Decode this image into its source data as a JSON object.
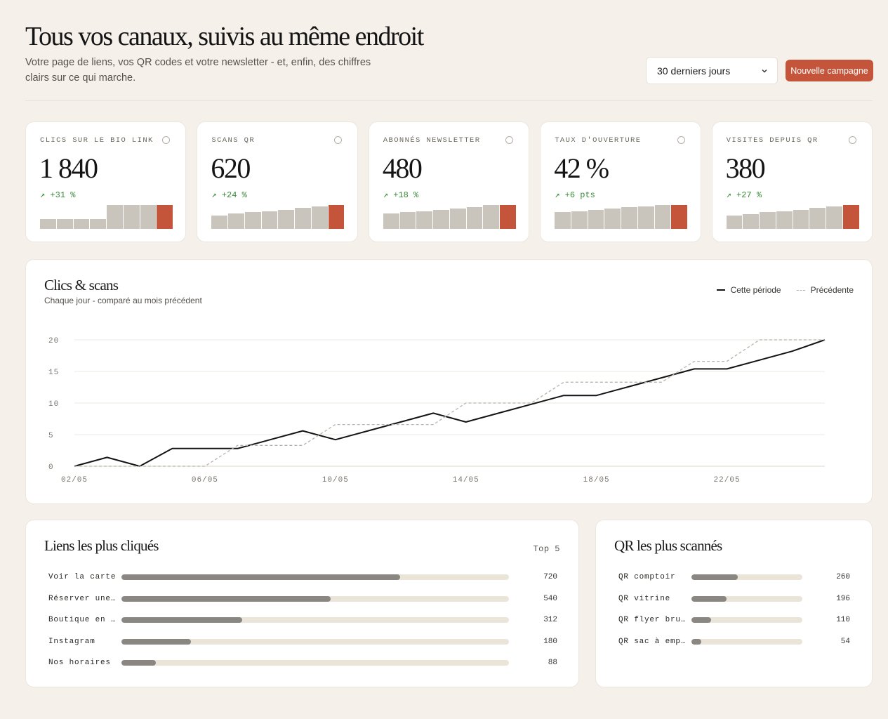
{
  "header": {
    "title": "Tous vos canaux, suivis au même endroit",
    "subtitle": "Votre page de liens, vos QR codes et votre newsletter - et, enfin, des chiffres clairs sur ce qui marche.",
    "period": "30 derniers jours",
    "cta": "Nouvelle campagne"
  },
  "kpis": [
    {
      "label": "CLICS SUR LE BIO LINK",
      "value": "1 840",
      "delta": "↗ +31 %",
      "spark": [
        0.4,
        0.4,
        0.4,
        0.4,
        1,
        1,
        1,
        1
      ]
    },
    {
      "label": "SCANS QR",
      "value": "620",
      "delta": "↗ +24 %",
      "spark": [
        0.55,
        0.65,
        0.7,
        0.75,
        0.8,
        0.88,
        0.95,
        1
      ]
    },
    {
      "label": "ABONNÉS NEWSLETTER",
      "value": "480",
      "delta": "↗ +18 %",
      "spark": [
        0.65,
        0.7,
        0.75,
        0.8,
        0.85,
        0.9,
        1,
        1
      ]
    },
    {
      "label": "TAUX D'OUVERTURE",
      "value": "42 %",
      "delta": "↗ +6 pts",
      "spark": [
        0.7,
        0.75,
        0.8,
        0.85,
        0.9,
        0.95,
        1,
        1
      ]
    },
    {
      "label": "VISITES DEPUIS QR",
      "value": "380",
      "delta": "↗ +27 %",
      "spark": [
        0.55,
        0.62,
        0.7,
        0.75,
        0.8,
        0.88,
        0.95,
        1
      ]
    }
  ],
  "main": {
    "title": "Clics & scans",
    "subtitle": "Chaque jour - comparé au mois précédent",
    "legend_current": "Cette période",
    "legend_previous": "Précédente"
  },
  "chart_data": {
    "type": "line",
    "x": [
      "02/05",
      "03/05",
      "04/05",
      "05/05",
      "06/05",
      "07/05",
      "08/05",
      "09/05",
      "10/05",
      "11/05",
      "12/05",
      "13/05",
      "14/05",
      "15/05",
      "16/05",
      "17/05",
      "18/05",
      "19/05",
      "20/05",
      "21/05",
      "22/05",
      "23/05",
      "24/05",
      "25/05"
    ],
    "x_ticks": [
      "02/05",
      "06/05",
      "10/05",
      "14/05",
      "18/05",
      "22/05"
    ],
    "y_ticks": [
      0,
      5,
      10,
      15,
      20
    ],
    "ylim": [
      0,
      20
    ],
    "grid": true,
    "legend": "top-right",
    "series": [
      {
        "name": "Cette période",
        "style": "solid",
        "values": [
          0,
          1.4,
          0,
          2.8,
          2.8,
          2.8,
          4.2,
          5.6,
          4.2,
          5.6,
          7.0,
          8.4,
          7.0,
          8.4,
          9.8,
          11.2,
          11.2,
          12.6,
          14.0,
          15.4,
          15.4,
          16.8,
          18.2,
          20
        ]
      },
      {
        "name": "Précédente",
        "style": "dashed",
        "values": [
          0,
          0,
          0,
          0,
          0,
          3.3,
          3.3,
          3.3,
          6.6,
          6.6,
          6.6,
          6.6,
          10,
          10,
          10,
          13.3,
          13.3,
          13.3,
          13.3,
          16.6,
          16.6,
          20,
          20,
          20
        ]
      }
    ],
    "colors": {
      "current": "#141414",
      "previous": "#b8b3aa"
    }
  },
  "links": {
    "title": "Liens les plus cliqués",
    "badge": "Top 5",
    "max": 1000,
    "items": [
      {
        "label": "Voir la carte",
        "value": 720
      },
      {
        "label": "Réserver une…",
        "value": 540
      },
      {
        "label": "Boutique en …",
        "value": 312
      },
      {
        "label": "Instagram",
        "value": 180
      },
      {
        "label": "Nos horaires",
        "value": 88
      }
    ]
  },
  "qrs": {
    "title": "QR les plus scannés",
    "max": 620,
    "items": [
      {
        "label": "QR comptoir",
        "value": 260
      },
      {
        "label": "QR vitrine",
        "value": 196
      },
      {
        "label": "QR flyer bru…",
        "value": 110
      },
      {
        "label": "QR sac à emp…",
        "value": 54
      }
    ]
  },
  "colors": {
    "accent": "#c4553a",
    "positive": "#3a8a3a",
    "background": "#f5f1ea"
  }
}
